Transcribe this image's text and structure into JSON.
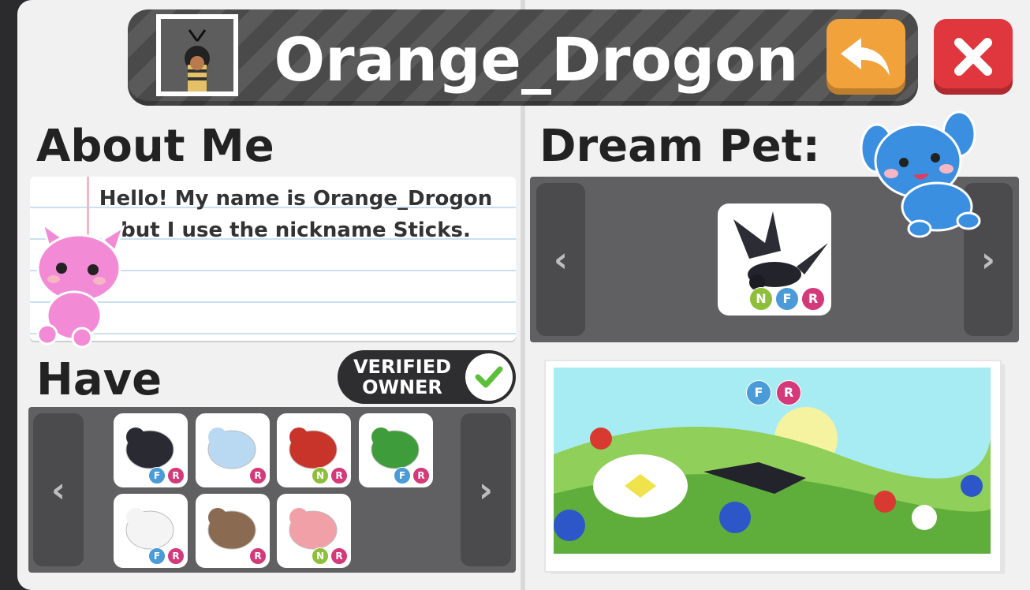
{
  "profile": {
    "username": "Orange_Drogon",
    "avatar_icon": "player-avatar"
  },
  "header": {
    "back_icon": "back-arrow-icon",
    "close_icon": "close-x-icon",
    "colors": {
      "back": "#f2a23a",
      "close": "#e0373e"
    }
  },
  "about": {
    "heading": "About Me",
    "line1": "Hello! My name is Orange_Drogon",
    "line2": "but I use the nickname Sticks."
  },
  "dream_pet": {
    "heading": "Dream Pet:",
    "pet_icon": "shadow-dragon-icon",
    "badges": [
      "N",
      "F",
      "R"
    ]
  },
  "have": {
    "heading": "Have",
    "verified_line1": "VERIFIED",
    "verified_line2": "OWNER",
    "prev_arrow": "‹",
    "next_arrow": "›",
    "pets": [
      {
        "icon": "shadow-dragon-icon",
        "badges": [
          "F",
          "R"
        ]
      },
      {
        "icon": "frost-dragon-icon",
        "badges": [
          "R"
        ]
      },
      {
        "icon": "chinese-dragon-icon",
        "badges": [
          "N",
          "R"
        ]
      },
      {
        "icon": "crocodile-icon",
        "badges": [
          "F",
          "R"
        ]
      },
      {
        "icon": "dalmatian-icon",
        "badges": [
          "F",
          "R"
        ]
      },
      {
        "icon": "kangaroo-icon",
        "badges": [
          "R"
        ]
      },
      {
        "icon": "axolotl-icon",
        "badges": [
          "N",
          "R"
        ]
      }
    ]
  },
  "showcase": {
    "badges": [
      "F",
      "R"
    ],
    "scene_icon": "flower-meadow-scene"
  },
  "dream_arrows": {
    "prev": "‹",
    "next": "›"
  }
}
